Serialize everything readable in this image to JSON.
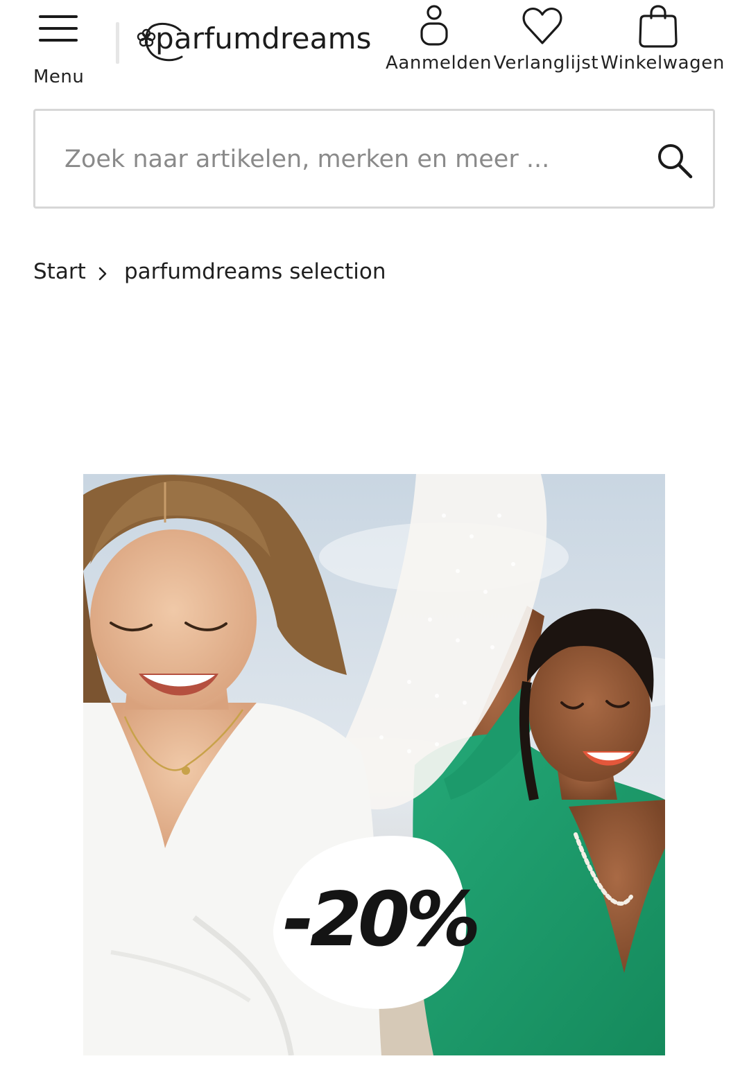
{
  "header": {
    "menu_label": "Menu",
    "logo_text": "parfumdreams",
    "nav": {
      "login_label": "Aanmelden",
      "wishlist_label": "Verlanglijst",
      "cart_label": "Winkelwagen"
    }
  },
  "search": {
    "placeholder": "Zoek naar artikelen, merken en meer ...",
    "value": ""
  },
  "breadcrumb": {
    "home": "Start",
    "current": "parfumdreams selection"
  },
  "hero": {
    "discount_text": "-20%",
    "discount_asterisk": "*"
  },
  "colors": {
    "text": "#1a1a1a",
    "border": "#d7d7d7",
    "dress_green": "#1f9a6a",
    "dress_white": "#f6f6f4",
    "sky": "#cfdbe6"
  },
  "icons": {
    "menu": "hamburger-icon",
    "logo": "flower-icon",
    "login": "user-icon",
    "wishlist": "heart-icon",
    "cart": "shopping-bag-icon",
    "search": "search-icon",
    "breadcrumb_separator": "chevron-right-icon"
  }
}
